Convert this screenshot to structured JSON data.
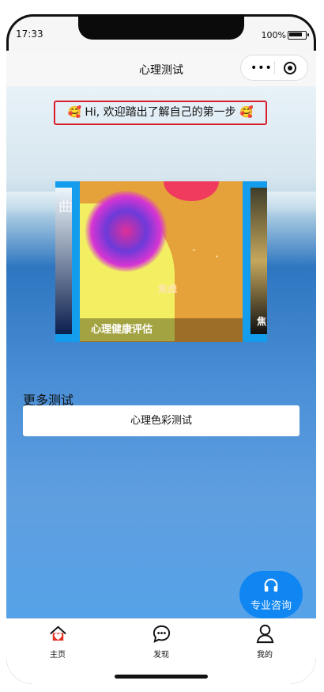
{
  "status": {
    "time": "17:33",
    "battery": "100%"
  },
  "nav": {
    "title": "心理测试"
  },
  "welcome": {
    "text": "🥰 Hi, 欢迎踏出了解自己的第一步 🥰"
  },
  "carousel": {
    "slides": [
      {
        "label": "心理健康评估"
      }
    ],
    "next_peek": "焦",
    "left_peek": "曲"
  },
  "more": {
    "title": "更多测试",
    "items": [
      {
        "label": "心理色彩测试"
      }
    ]
  },
  "consult": {
    "label": "专业咨询"
  },
  "tabs": [
    {
      "label": "主页"
    },
    {
      "label": "发现"
    },
    {
      "label": "我的"
    }
  ]
}
